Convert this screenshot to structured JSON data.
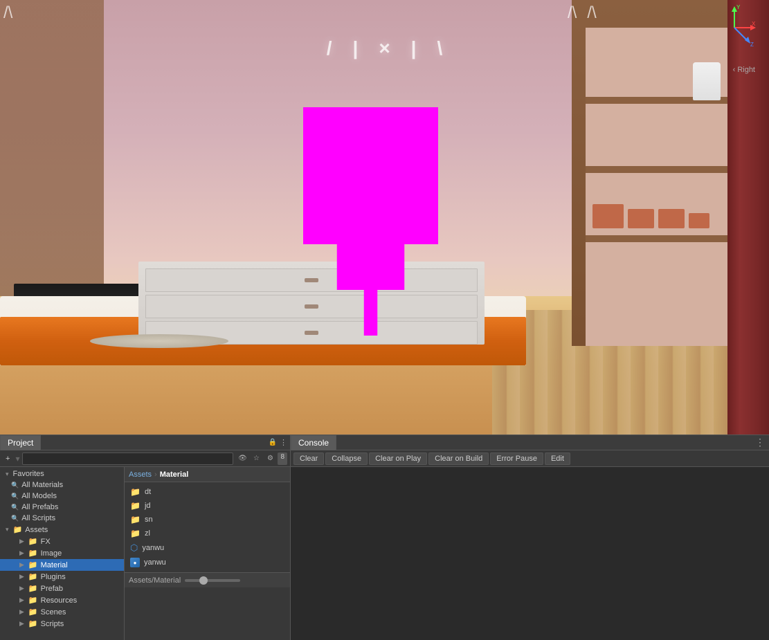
{
  "panels": {
    "project": {
      "tab_label": "Project",
      "toolbar": {
        "add_btn": "+",
        "search_placeholder": "",
        "badge": "8"
      },
      "tree": {
        "favorites": [
          {
            "label": "All Materials",
            "indent": 1
          },
          {
            "label": "All Models",
            "indent": 1
          },
          {
            "label": "All Prefabs",
            "indent": 1
          },
          {
            "label": "All Scripts",
            "indent": 1
          }
        ],
        "assets": {
          "label": "Assets",
          "children": [
            {
              "label": "FX",
              "indent": 2
            },
            {
              "label": "Image",
              "indent": 2
            },
            {
              "label": "Material",
              "indent": 2,
              "selected": true
            },
            {
              "label": "Plugins",
              "indent": 2
            },
            {
              "label": "Prefab",
              "indent": 2
            },
            {
              "label": "Resources",
              "indent": 2
            },
            {
              "label": "Scenes",
              "indent": 2
            },
            {
              "label": "Scripts",
              "indent": 2
            }
          ]
        }
      },
      "breadcrumb": {
        "root": "Assets",
        "sep": "›",
        "current": "Material"
      },
      "files": [
        {
          "name": "dt",
          "type": "folder"
        },
        {
          "name": "jd",
          "type": "folder"
        },
        {
          "name": "sn",
          "type": "folder"
        },
        {
          "name": "zl",
          "type": "folder"
        },
        {
          "name": "yanwu",
          "type": "unity"
        },
        {
          "name": "yanwu",
          "type": "material"
        }
      ],
      "footer": {
        "path": "Assets/Material"
      }
    },
    "console": {
      "tab_label": "Console",
      "toolbar": {
        "clear_btn": "Clear",
        "collapse_btn": "Collapse",
        "clear_on_play_btn": "Clear on Play",
        "clear_on_build_btn": "Clear on Build",
        "error_pause_btn": "Error Pause",
        "editor_btn": "Edit"
      }
    }
  },
  "gizmo": {
    "right_label": "‹ Right"
  },
  "scene": {
    "light_symbols": [
      "/",
      "|",
      "×",
      "|",
      "\\"
    ]
  }
}
